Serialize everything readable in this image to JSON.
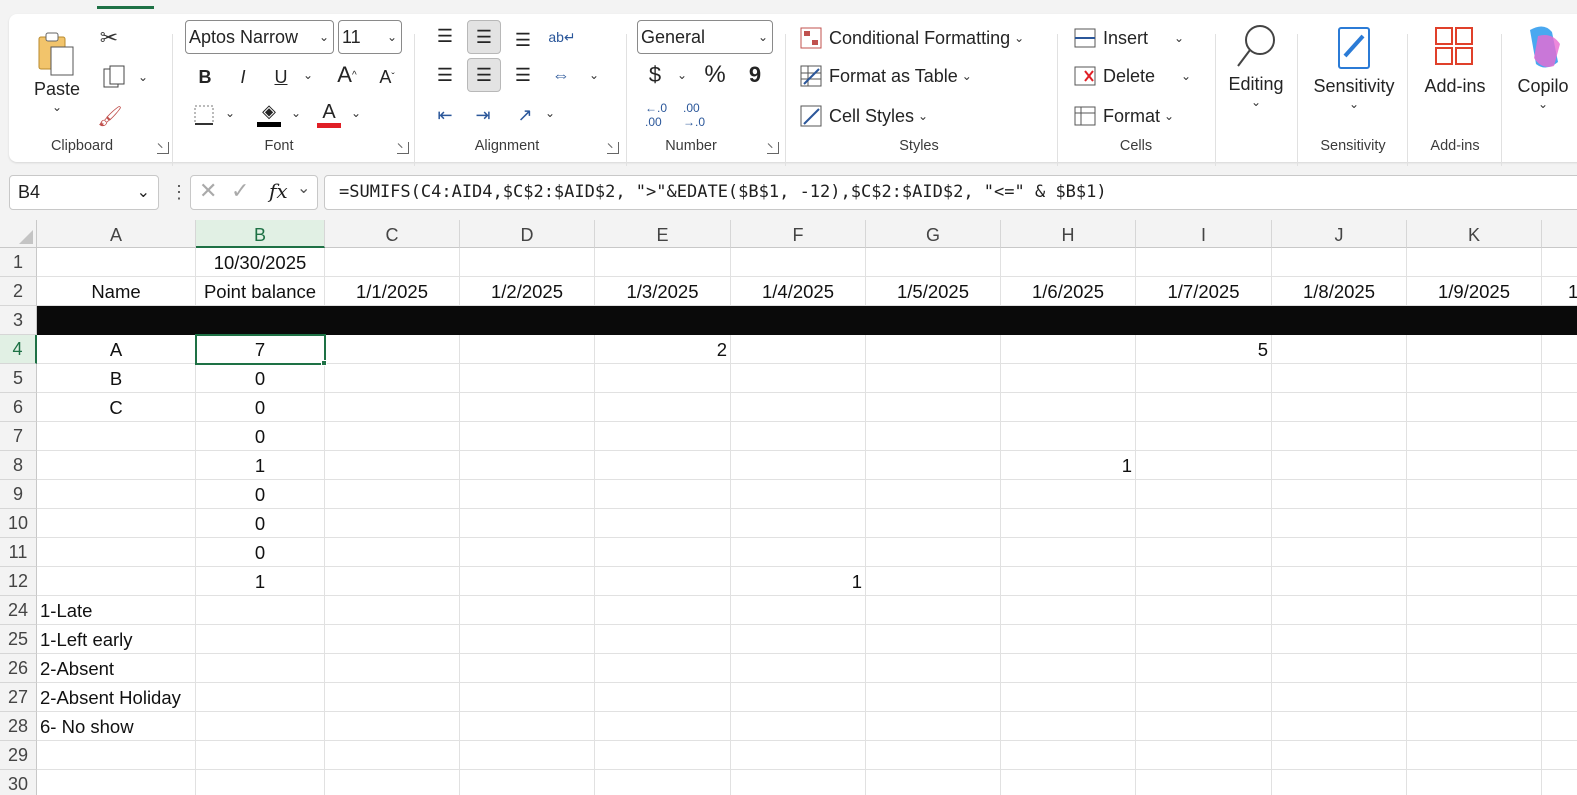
{
  "ribbon": {
    "clipboard": {
      "paste_label": "Paste",
      "group_label": "Clipboard"
    },
    "font": {
      "font_name": "Aptos Narrow",
      "font_size": "11",
      "group_label": "Font",
      "bold": "B",
      "italic": "I",
      "underline": "U",
      "grow": "A",
      "shrink": "A",
      "font_color_letter": "A"
    },
    "alignment": {
      "group_label": "Alignment"
    },
    "number": {
      "format": "General",
      "currency": "$",
      "percent": "%",
      "comma": "9",
      "group_label": "Number"
    },
    "styles": {
      "conditional": "Conditional Formatting",
      "format_table": "Format as Table",
      "cell_styles": "Cell Styles",
      "group_label": "Styles"
    },
    "cells": {
      "insert": "Insert",
      "delete": "Delete",
      "format": "Format",
      "group_label": "Cells"
    },
    "editing": {
      "label": "Editing"
    },
    "sensitivity": {
      "label": "Sensitivity",
      "group_label": "Sensitivity"
    },
    "addins": {
      "label": "Add-ins",
      "group_label": "Add-ins"
    },
    "copilot": {
      "label": "Copilo"
    }
  },
  "formula_bar": {
    "name_box": "B4",
    "formula": "=SUMIFS(C4:AID4,$C$2:$AID$2, \">\"&EDATE($B$1, -12),$C$2:$AID$2, \"<=\" & $B$1)"
  },
  "columns": [
    "A",
    "B",
    "C",
    "D",
    "E",
    "F",
    "G",
    "H",
    "I",
    "J",
    "K"
  ],
  "rows": [
    "1",
    "2",
    "3",
    "4",
    "5",
    "6",
    "7",
    "8",
    "9",
    "10",
    "11",
    "12",
    "24",
    "25",
    "26",
    "27",
    "28",
    "29",
    "30"
  ],
  "cells": {
    "B1": "10/30/2025",
    "A2": "Name",
    "B2": "Point balance",
    "C2": "1/1/2025",
    "D2": "1/2/2025",
    "E2": "1/3/2025",
    "F2": "1/4/2025",
    "G2": "1/5/2025",
    "H2": "1/6/2025",
    "I2": "1/7/2025",
    "J2": "1/8/2025",
    "K2": "1/9/2025",
    "L2": "1",
    "A4": "A",
    "B4": "7",
    "E4": "2",
    "I4": "5",
    "A5": "B",
    "B5": "0",
    "A6": "C",
    "B6": "0",
    "B7": "0",
    "B8": "1",
    "H8": "1",
    "B9": "0",
    "B10": "0",
    "B11": "0",
    "B12": "1",
    "F12": "1",
    "A24": "1-Late",
    "A25": "1-Left early",
    "A26": "2-Absent",
    "A27": "2-Absent Holiday",
    "A28": "6- No show"
  },
  "colors": {
    "accent": "#1e7145",
    "black_row": "#0a0a0a"
  }
}
